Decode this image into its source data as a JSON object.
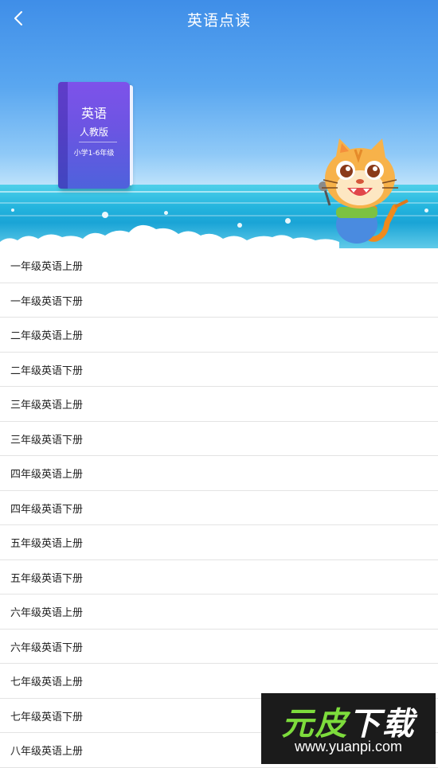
{
  "header": {
    "title": "英语点读",
    "back_icon": "chevron-left-icon"
  },
  "book": {
    "subject": "英语",
    "edition": "人教版",
    "grades": "小学1-6年级",
    "cover_color": "#6b55e2"
  },
  "banner": {
    "mascot": "cartoon-cat-icon",
    "sky_color": "#3f8ee8",
    "sea_color": "#1aa4d6"
  },
  "list": {
    "items": [
      {
        "label": "一年级英语上册"
      },
      {
        "label": "一年级英语下册"
      },
      {
        "label": "二年级英语上册"
      },
      {
        "label": "二年级英语下册"
      },
      {
        "label": "三年级英语上册"
      },
      {
        "label": "三年级英语下册"
      },
      {
        "label": "四年级英语上册"
      },
      {
        "label": "四年级英语下册"
      },
      {
        "label": "五年级英语上册"
      },
      {
        "label": "五年级英语下册"
      },
      {
        "label": "六年级英语上册"
      },
      {
        "label": "六年级英语下册"
      },
      {
        "label": "七年级英语上册"
      },
      {
        "label": "七年级英语下册"
      },
      {
        "label": "八年级英语上册"
      }
    ]
  },
  "watermark": {
    "logo_green": "元皮",
    "logo_white": "下载",
    "url": "www.yuanpi.com"
  }
}
